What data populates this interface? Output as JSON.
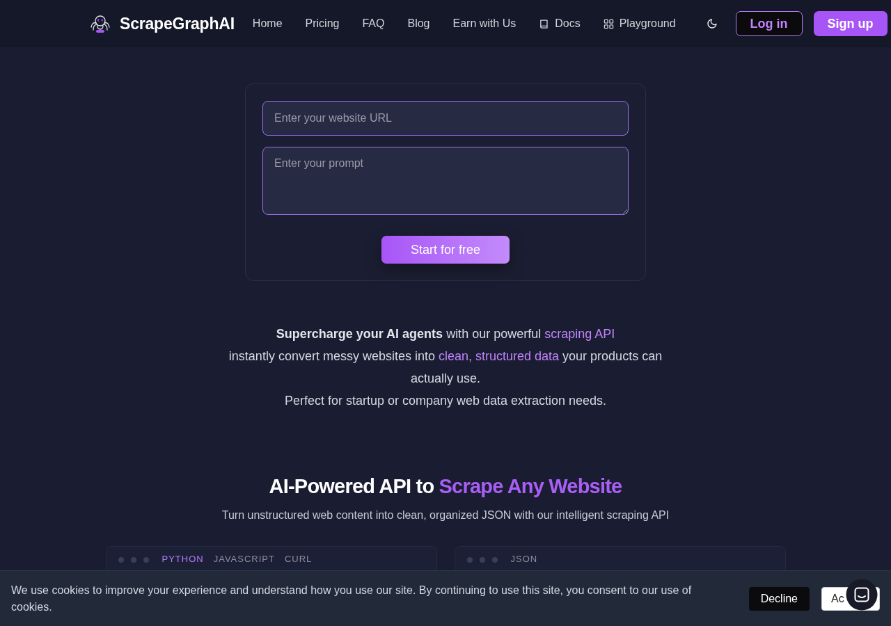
{
  "header": {
    "brand": "ScrapeGraphAI",
    "nav": [
      {
        "label": "Home",
        "kind": "text"
      },
      {
        "label": "Pricing",
        "kind": "text"
      },
      {
        "label": "FAQ",
        "kind": "text"
      },
      {
        "label": "Blog",
        "kind": "text"
      },
      {
        "label": "Earn with Us",
        "kind": "text"
      },
      {
        "label": "Docs",
        "kind": "book"
      },
      {
        "label": "Playground",
        "kind": "grid"
      }
    ],
    "login": "Log in",
    "signup": "Sign up"
  },
  "form": {
    "url_field": {
      "placeholder": "Enter your website URL"
    },
    "prompt_field": {
      "placeholder": "Enter your prompt"
    },
    "submit": "Start for free"
  },
  "intro": {
    "lines": [
      [
        {
          "text": "Supercharge your AI agents",
          "kind": "strong"
        },
        {
          "text": " with our powerful ",
          "kind": "text"
        },
        {
          "text": "scraping API",
          "kind": "highlight"
        }
      ],
      [
        {
          "text": "instantly convert messy websites into ",
          "kind": "text"
        },
        {
          "text": "clean, structured data",
          "kind": "highlight"
        },
        {
          "text": " your products can actually use.",
          "kind": "text"
        }
      ],
      [
        {
          "text": "Perfect for startup or company web data extraction needs.",
          "kind": "text"
        }
      ]
    ]
  },
  "features": {
    "title": [
      {
        "text": "AI-Powered API to ",
        "kind": "text"
      },
      {
        "text": "Scrape Any Website",
        "kind": "highlight"
      }
    ],
    "subtitle": "Turn unstructured web content into clean, organized JSON with our intelligent scraping API"
  },
  "code_panels": [
    {
      "tabs": [
        {
          "label": "PYTHON",
          "selected": true
        },
        {
          "label": "JAVASCRIPT",
          "selected": false
        },
        {
          "label": "CURL",
          "selected": false
        }
      ]
    },
    {
      "label": "JSON"
    }
  ],
  "cookie_banner": {
    "message": "We use cookies to improve your experience and understand how you use our site. By continuing to use this site, you consent to our use of cookies.",
    "buttons": [
      {
        "label": "Decline",
        "kind": "dark"
      },
      {
        "label": "Ac",
        "kind": "light"
      }
    ]
  }
}
